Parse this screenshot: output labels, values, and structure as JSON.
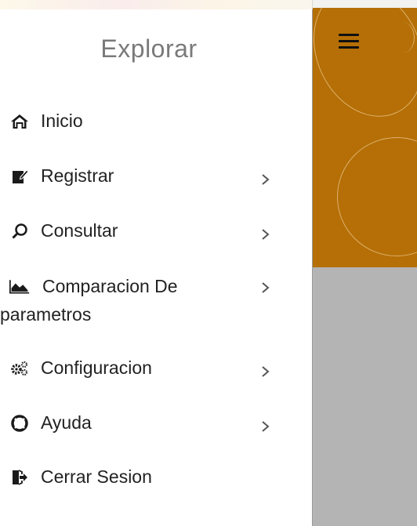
{
  "drawer": {
    "title": "Explorar",
    "items": [
      {
        "label": "Inicio",
        "icon": "home-icon",
        "has_submenu": false
      },
      {
        "label": "Registrar",
        "icon": "edit-icon",
        "has_submenu": true
      },
      {
        "label": "Consultar",
        "icon": "search-icon",
        "has_submenu": true
      },
      {
        "label": "Comparacion De parametros",
        "label_line1": "Comparacion De",
        "label_line2": "parametros",
        "icon": "area-chart-icon",
        "has_submenu": true
      },
      {
        "label": "Configuracion",
        "icon": "gears-icon",
        "has_submenu": true
      },
      {
        "label": "Ayuda",
        "icon": "lifebuoy-icon",
        "has_submenu": true
      },
      {
        "label": "Cerrar Sesion",
        "icon": "sign-out-icon",
        "has_submenu": false
      }
    ]
  },
  "colors": {
    "header": "#b56f06",
    "background": "#b4b4b4",
    "drawer": "#ffffff",
    "title": "#7a7a7a"
  }
}
